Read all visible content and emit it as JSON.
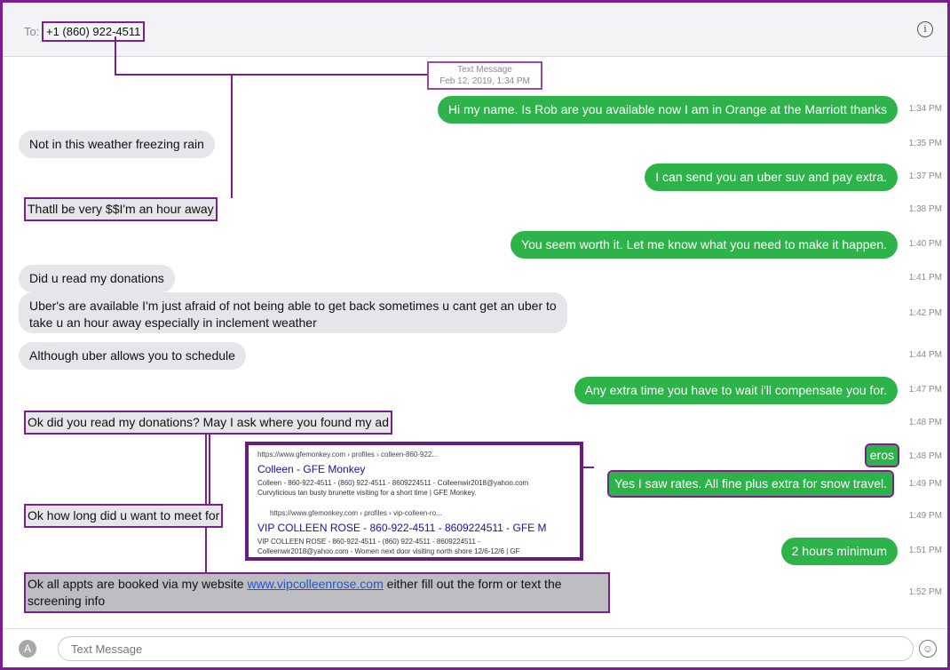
{
  "header": {
    "to_label": "To:",
    "recipient": "+1 (860) 922-4511",
    "info_icon": "info-icon"
  },
  "meta": {
    "line1": "Text Message",
    "line2": "Feb 12, 2019, 1:34 PM"
  },
  "messages": [
    {
      "text": "Hi my name.  Is Rob are you available now I am in Orange at the Marriott thanks",
      "time": "1:34 PM"
    },
    {
      "text": "Not in this weather freezing rain",
      "time": "1:35 PM"
    },
    {
      "text": "I can send you an uber suv and pay extra.",
      "time": "1:37 PM"
    },
    {
      "text": "Thatll be very $$I'm an hour away",
      "time": "1:38 PM"
    },
    {
      "text": "You seem worth it. Let me know what you need to make it happen.",
      "time": "1:40 PM"
    },
    {
      "text": "Did u read my donations",
      "time": "1:41 PM"
    },
    {
      "text_line1": "Uber's are available I'm just afraid of not being able to get back sometimes u cant get an uber to",
      "text_line2": "take u an hour away especially in inclement weather",
      "time": "1:42 PM"
    },
    {
      "text": "Although uber allows you to schedule",
      "time": "1:44 PM"
    },
    {
      "text": "Any extra time you have to wait i'll compensate you for.",
      "time": "1:47 PM"
    },
    {
      "text": "Ok did you read my donations? May I ask where you found my ad",
      "time": "1:48 PM"
    },
    {
      "text": "eros",
      "time": "1:48 PM"
    },
    {
      "text": "Yes I saw rates.  All fine plus extra for snow travel.",
      "time": "1:49 PM"
    },
    {
      "text": "Ok how long did u want to meet for",
      "time": "1:49 PM"
    },
    {
      "text": "2 hours minimum",
      "time": "1:51 PM"
    },
    {
      "text_before": "Ok all appts are booked via my website ",
      "link": "www.vipcolleenrose.com",
      "text_after": " either fill out the form or text the",
      "text_line2": "screening info",
      "time": "1:52 PM"
    }
  ],
  "search_results": [
    {
      "url": "https://www.gfemonkey.com › profiles › colleen-860-922...",
      "title": "Colleen - GFE Monkey",
      "snippet1": "Colleen - 860-922-4511 - (860) 922-4511 - 8609224511 - Colleenwir2018@yahoo.com",
      "snippet2": "Curvylicious tan busty brunette visiting for a short time | GFE Monkey."
    },
    {
      "url": "https://www.gfemonkey.com › profiles › vip-colleen-ro...",
      "title": "VIP COLLEEN ROSE - 860-922-4511 - 8609224511 - GFE M",
      "snippet1": "VIP COLLEEN ROSE - 860-922-4511 - (860) 922-4511 - 8609224511 -",
      "snippet2": "Colleenwir2018@yahoo.com - Women next door visiting north shore 12/6-12/6 | GF"
    }
  ],
  "compose": {
    "placeholder": "Text Message",
    "app_icon": "appstore-icon",
    "emoji_icon": "emoji-icon"
  },
  "colors": {
    "outgoing": "#2db34a",
    "incoming": "#e6e6ea",
    "highlight": "#7a1f8c"
  }
}
